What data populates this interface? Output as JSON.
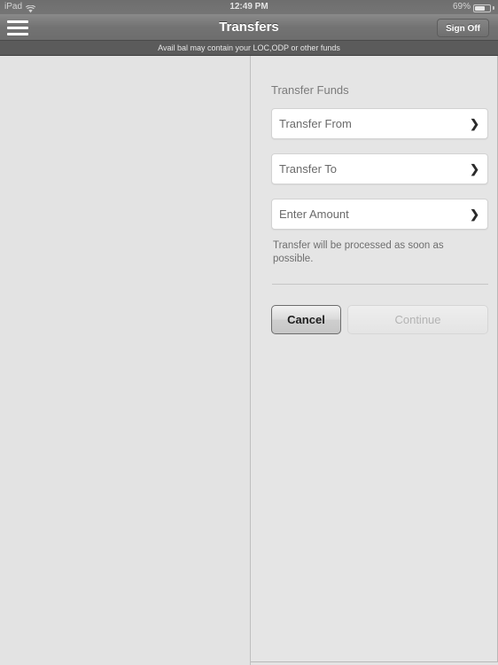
{
  "status_bar": {
    "device": "iPad",
    "wifi_icon": "wifi-icon",
    "time": "12:49 PM",
    "battery_percent": "69%",
    "battery_icon": "battery-icon"
  },
  "nav_bar": {
    "menu_icon": "hamburger-menu-icon",
    "title": "Transfers",
    "sign_off_label": "Sign Off"
  },
  "notice": {
    "text": "Avail bal may contain your LOC,ODP or other funds"
  },
  "panel": {
    "section_title": "Transfer Funds",
    "fields": [
      {
        "label": "Transfer From",
        "chevron": "❯"
      },
      {
        "label": "Transfer To",
        "chevron": "❯"
      },
      {
        "label": "Enter Amount",
        "chevron": "❯"
      }
    ],
    "helper_text": "Transfer will be processed as soon as possible.",
    "buttons": {
      "cancel_label": "Cancel",
      "continue_label": "Continue"
    }
  },
  "colors": {
    "navbar": "#757575",
    "notice_bar": "#5b5b5b",
    "page_background": "#e4e4e4",
    "field_background": "#ffffff",
    "disabled_text": "#b3b3b3"
  }
}
